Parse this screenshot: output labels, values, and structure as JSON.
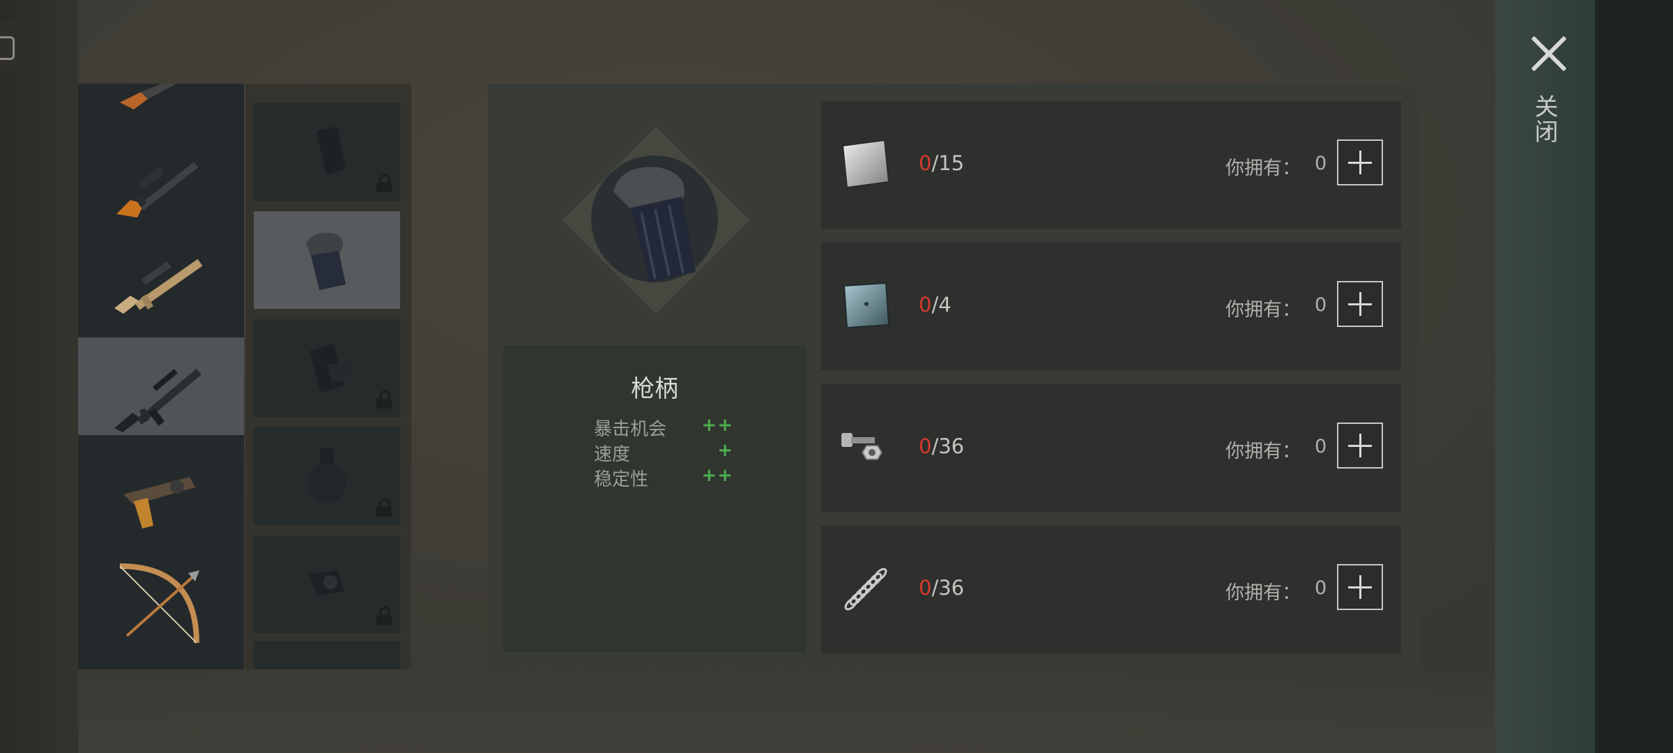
{
  "window": {
    "close_label": "关闭"
  },
  "weapons": [
    {
      "name": "rifle-partial-icon"
    },
    {
      "name": "sniper-rifle-icon"
    },
    {
      "name": "assault-rifle-tan-icon"
    },
    {
      "name": "assault-rifle-m16-icon",
      "selected": true
    },
    {
      "name": "pistol-icon"
    },
    {
      "name": "bow-icon"
    }
  ],
  "attachments": [
    {
      "name": "magazine-icon",
      "locked": true
    },
    {
      "name": "grip-icon",
      "selected": true
    },
    {
      "name": "extended-magazine-icon",
      "locked": true
    },
    {
      "name": "drum-magazine-icon",
      "locked": true
    },
    {
      "name": "sight-icon",
      "locked": true
    }
  ],
  "part": {
    "name": "枪柄",
    "stats": [
      {
        "label": "暴击机会",
        "value": "++"
      },
      {
        "label": "速度",
        "value": "+"
      },
      {
        "label": "稳定性",
        "value": "++"
      }
    ]
  },
  "materials": [
    {
      "icon": "metal-sheet-icon",
      "have": "0",
      "need": "/15",
      "own_label": "你拥有：",
      "own_value": "0"
    },
    {
      "icon": "metal-plate-icon",
      "have": "0",
      "need": "/4",
      "own_label": "你拥有：",
      "own_value": "0"
    },
    {
      "icon": "bolt-nut-icon",
      "have": "0",
      "need": "/36",
      "own_label": "你拥有：",
      "own_value": "0"
    },
    {
      "icon": "spring-icon",
      "have": "0",
      "need": "/36",
      "own_label": "你拥有：",
      "own_value": "0"
    }
  ],
  "colors": {
    "missing": "#d63a2d",
    "stat_positive": "#4caf50"
  }
}
